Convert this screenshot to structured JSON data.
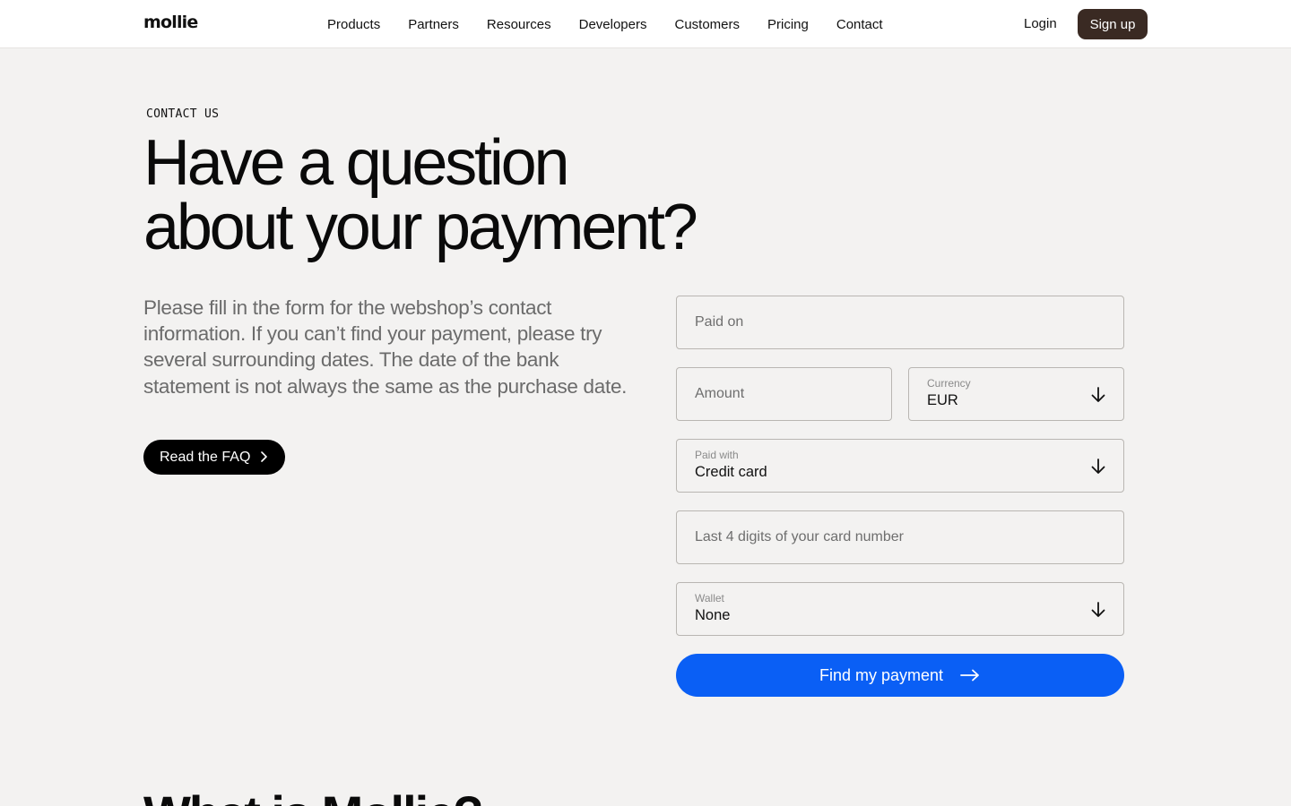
{
  "header": {
    "logo": "mollie",
    "nav": [
      "Products",
      "Partners",
      "Resources",
      "Developers",
      "Customers",
      "Pricing",
      "Contact"
    ],
    "login": "Login",
    "signup": "Sign up"
  },
  "hero": {
    "eyebrow": "CONTACT US",
    "title_line1": "Have a question",
    "title_line2": "about your payment?",
    "intro": "Please fill in the form for the webshop’s contact information. If you can’t find your payment, please try several surrounding dates. The date of the bank statement is not always the same as the purchase date.",
    "faq_button": "Read the FAQ"
  },
  "form": {
    "paid_on": {
      "placeholder": "Paid on"
    },
    "amount": {
      "placeholder": "Amount"
    },
    "currency": {
      "label": "Currency",
      "value": "EUR"
    },
    "paid_with": {
      "label": "Paid with",
      "value": "Credit card"
    },
    "last4": {
      "placeholder": "Last 4 digits of your card number"
    },
    "wallet": {
      "label": "Wallet",
      "value": "None"
    },
    "submit": "Find my payment"
  },
  "next_section": {
    "heading": "What is Mollie?"
  },
  "icons": {
    "dropdown": "arrow-down-icon",
    "faq": "chevron-right-icon",
    "submit": "arrow-right-icon"
  },
  "colors": {
    "background": "#f3f2f1",
    "signup_bg": "#3a2a23",
    "primary_blue": "#0a5ff5",
    "faq_bg": "#000000"
  }
}
